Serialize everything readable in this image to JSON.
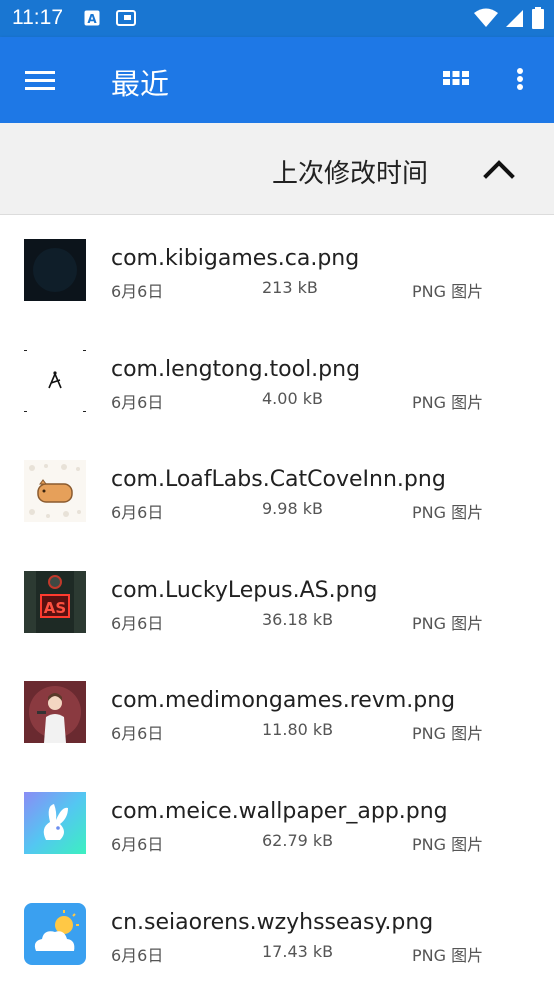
{
  "status_bar": {
    "time": "11:17",
    "icons": [
      "text-icon",
      "screen-icon",
      "wifi-icon",
      "signal-icon",
      "battery-icon"
    ]
  },
  "app_bar": {
    "title": "最近",
    "menu_icon": "hamburger-menu-icon",
    "view_icon": "grid-view-icon",
    "more_icon": "more-vert-icon",
    "color": "#1e78e6"
  },
  "sort_bar": {
    "label": "上次修改时间",
    "direction_icon": "chevron-up-icon"
  },
  "files": [
    {
      "name": "com.kibigames.ca.png",
      "date": "6月6日",
      "size": "213 kB",
      "type": "PNG 图片",
      "thumb": "dark-circle"
    },
    {
      "name": "com.lengtong.tool.png",
      "date": "6月6日",
      "size": "4.00 kB",
      "type": "PNG 图片",
      "thumb": "compass-tool"
    },
    {
      "name": "com.LoafLabs.CatCoveInn.png",
      "date": "6月6日",
      "size": "9.98 kB",
      "type": "PNG 图片",
      "thumb": "cat-loaf"
    },
    {
      "name": "com.LuckyLepus.AS.png",
      "date": "6月6日",
      "size": "36.18 kB",
      "type": "PNG 图片",
      "thumb": "as-sign"
    },
    {
      "name": "com.medimongames.revm.png",
      "date": "6月6日",
      "size": "11.80 kB",
      "type": "PNG 图片",
      "thumb": "character"
    },
    {
      "name": "com.meice.wallpaper_app.png",
      "date": "6月6日",
      "size": "62.79 kB",
      "type": "PNG 图片",
      "thumb": "rabbit"
    },
    {
      "name": "cn.seiaorens.wzyhsseasy.png",
      "date": "6月6日",
      "size": "17.43 kB",
      "type": "PNG 图片",
      "thumb": "weather"
    }
  ]
}
